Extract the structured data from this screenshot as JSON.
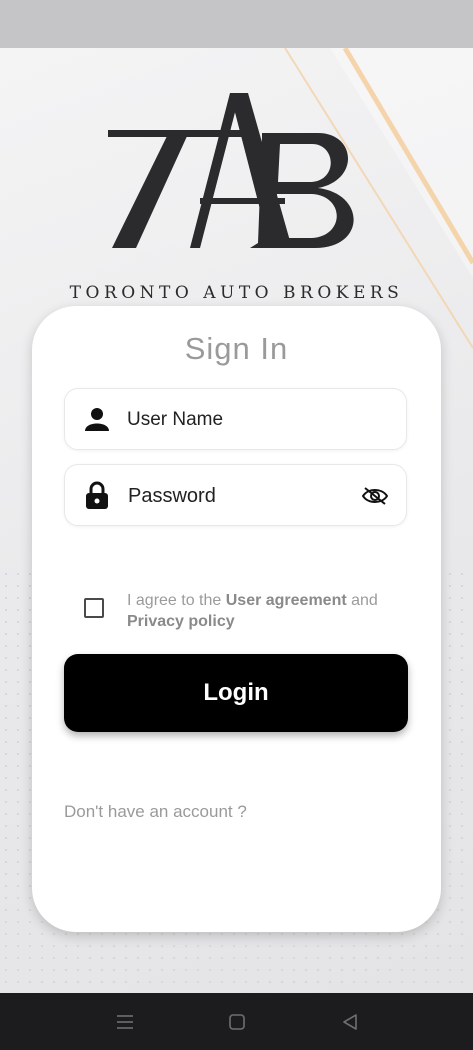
{
  "brand": {
    "logo_letters": "TAB",
    "name": "TORONTO AUTO BROKERS"
  },
  "signin": {
    "title": "Sign In",
    "username_placeholder": "User Name",
    "password_placeholder": "Password",
    "agree_prefix": "I agree to the ",
    "agree_link1": "User agreement",
    "agree_mid": " and",
    "agree_link2": "Privacy policy",
    "login_label": "Login",
    "no_account": "Don't have an account ?"
  },
  "icons": {
    "username": "person-icon",
    "password": "lock-icon",
    "visibility": "eye-off-icon",
    "nav": [
      "menu-icon",
      "home-icon",
      "back-icon"
    ]
  },
  "colors": {
    "accent_line": "#f2b66a",
    "button": "#000000",
    "title": "#9a9a9a"
  }
}
